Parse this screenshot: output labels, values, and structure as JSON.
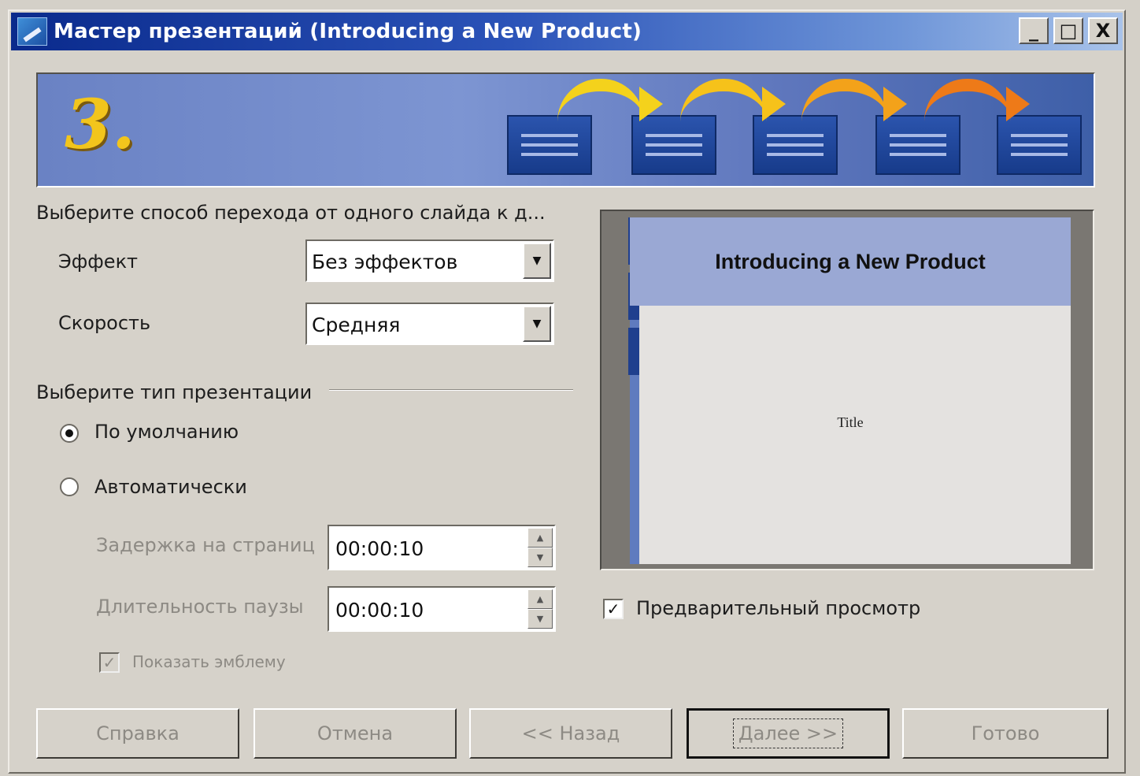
{
  "window": {
    "title": "Мастер презентаций (Introducing a New Product)",
    "controls": {
      "minimize": "_",
      "maximize": "□",
      "close": "X"
    }
  },
  "banner": {
    "step_number": "3."
  },
  "transition": {
    "heading": "Выберите способ перехода от одного слайда к д...",
    "effect_label": "Эффект",
    "effect_value": "Без эффектов",
    "speed_label": "Скорость",
    "speed_value": "Средняя"
  },
  "presentation_type": {
    "heading": "Выберите тип презентации",
    "options": [
      {
        "label": "По умолчанию",
        "selected": true
      },
      {
        "label": "Автоматически",
        "selected": false
      }
    ],
    "delay_label": "Задержка на страниц",
    "delay_value": "00:00:10",
    "pause_label": "Длительность паузы",
    "pause_value": "00:00:10",
    "show_logo_label": "Показать эмблему",
    "show_logo_checked": true
  },
  "preview": {
    "slide_title": "Introducing a New Product",
    "slide_subtitle": "Title",
    "checkbox_label": "Предварительный просмотр",
    "checkbox_checked": true
  },
  "buttons": {
    "help": "Справка",
    "cancel": "Отмена",
    "back": "<< Назад",
    "next": "Далее >>",
    "finish": "Готово"
  }
}
